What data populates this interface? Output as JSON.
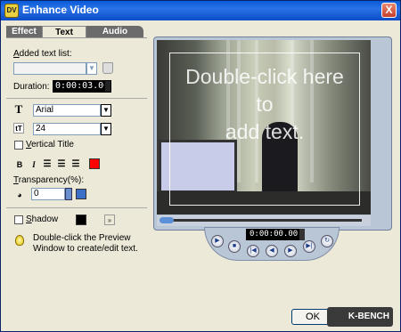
{
  "window": {
    "title": "Enhance Video",
    "close_glyph": "X"
  },
  "tabs": [
    {
      "label": "Effect",
      "active": false
    },
    {
      "label": "Text",
      "active": true
    },
    {
      "label": "Audio",
      "active": false
    }
  ],
  "text_panel": {
    "added_text_label_prefix": "A",
    "added_text_label_rest": "dded text list:",
    "added_text_value": "",
    "duration_label": "Duration:",
    "duration_value": "0:00:03.00",
    "font_icon": "T",
    "font_value": "Arial",
    "size_value": "24",
    "vertical_label_prefix": "V",
    "vertical_label_rest": "ertical Title",
    "vertical_checked": false,
    "bold_glyph": "B",
    "italic_glyph": "I",
    "color_swatch": "#ff0000",
    "transparency_label_prefix": "T",
    "transparency_label_rest": "ransparency(%):",
    "transparency_value": "0",
    "shadow_label_prefix": "S",
    "shadow_label_rest": "hadow",
    "shadow_checked": false,
    "shadow_color": "#000000",
    "hint": "Double-click the Preview Window to create/edit text.",
    "hint_line1": "Double-click the Preview",
    "hint_line2": "Window to create/edit text."
  },
  "preview": {
    "overlay_line1": "Double-click here",
    "overlay_line2": "to",
    "overlay_line3": "add text.",
    "progress": 0.0
  },
  "player": {
    "timecode": "0:00:00.00"
  },
  "footer": {
    "ok_label": "OK",
    "watermark": "K-BENCH"
  }
}
